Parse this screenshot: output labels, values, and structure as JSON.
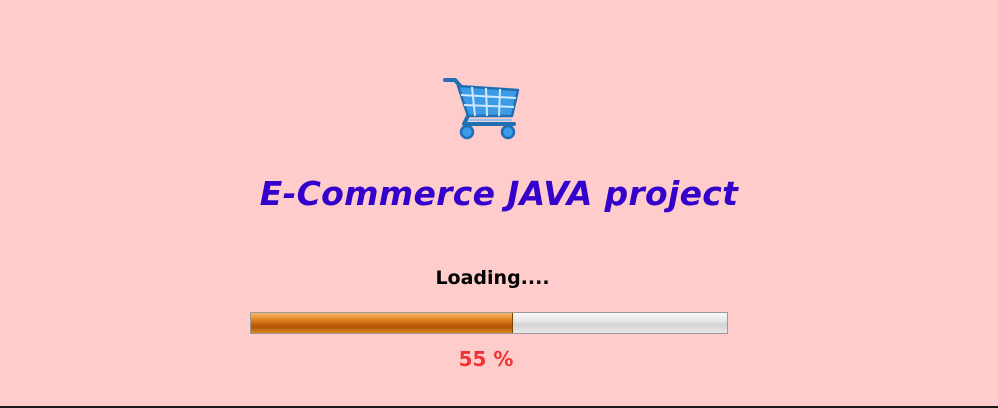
{
  "splash": {
    "icon": "shopping-cart-icon",
    "title": "E-Commerce JAVA project",
    "loading_text": "Loading....",
    "progress_percent": 55,
    "progress_text": "55 %"
  },
  "colors": {
    "background": "#ffcccc",
    "title": "#3300cc",
    "progress_fill": "#c8650a",
    "progress_track": "#e4e4e4",
    "percent_text": "#ee3333"
  }
}
